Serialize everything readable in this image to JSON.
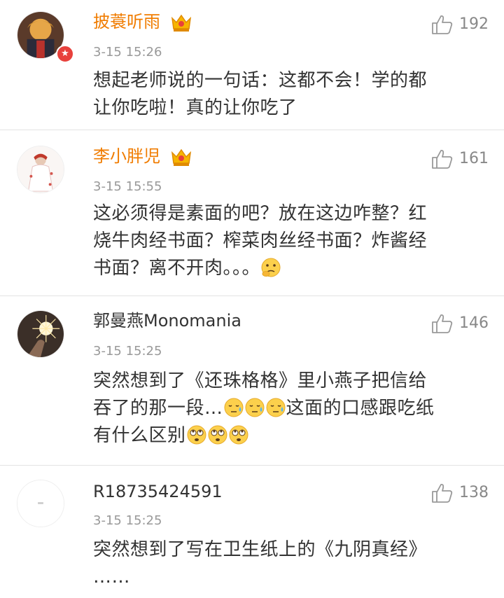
{
  "comments": [
    {
      "user": "披蓑听雨",
      "time": "3-15 15:26",
      "likes": "192",
      "lines": [
        "想起老师说的一句话：这都不会！学的都",
        "让你吃啦！真的让你吃了"
      ]
    },
    {
      "user": "李小胖児",
      "time": "3-15 15:55",
      "likes": "161",
      "lines": [
        "这必须得是素面的吧？放在这边咋整？红",
        "烧牛肉经书面？榨菜肉丝经书面？炸酱经",
        "书面？离不开肉。。。"
      ]
    },
    {
      "user": "郭曼燕Monomania",
      "time": "3-15 15:25",
      "likes": "146",
      "lines": [
        "突然想到了《还珠格格》里小燕子把信给",
        "吞了的那一段…",
        "这面的口感跟吃纸",
        "有什么区别"
      ]
    },
    {
      "user": "R18735424591",
      "time": "3-15 15:25",
      "likes": "138",
      "lines": [
        "突然想到了写在卫生纸上的《九阴真经》",
        "……"
      ]
    }
  ],
  "colors": {
    "vip_name": "#f07c00",
    "verified_badge": "#e8413c",
    "meta": "#999999"
  },
  "icons": {
    "like": "thumbs-up-icon",
    "vip": "crown-icon",
    "verified": "verified-badge-icon"
  }
}
